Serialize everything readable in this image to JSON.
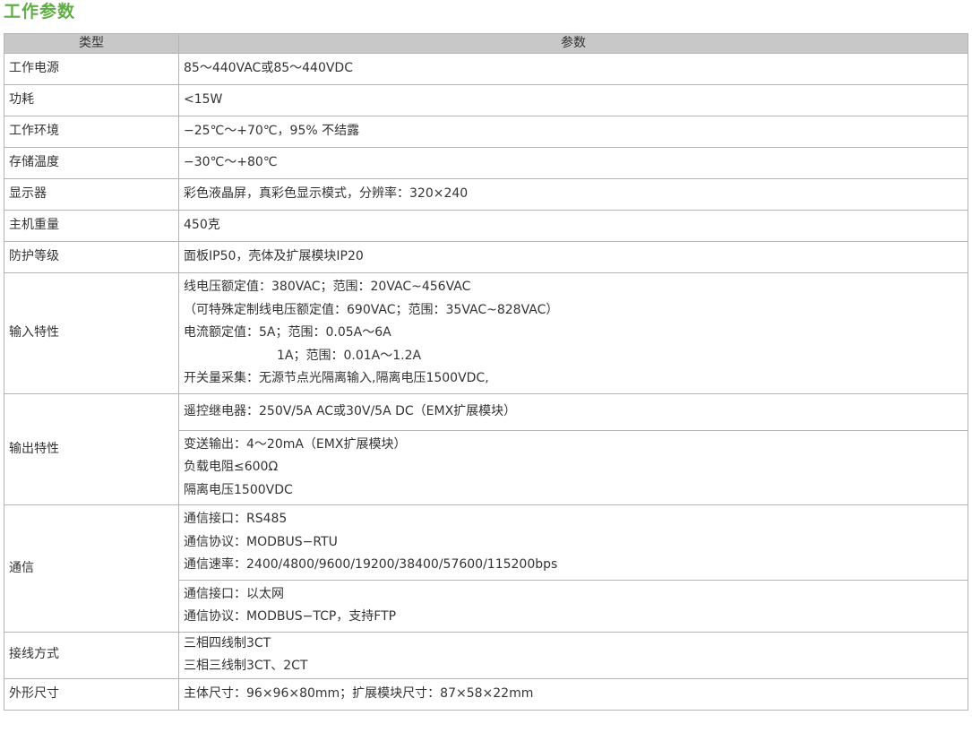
{
  "page": {
    "title": "工作参数"
  },
  "table": {
    "headers": {
      "type": "类型",
      "param": "参数"
    },
    "rows": {
      "power": {
        "label": "工作电源",
        "value": "85～440VAC或85～440VDC"
      },
      "consumption": {
        "label": "功耗",
        "value": "<15W"
      },
      "env": {
        "label": "工作环境",
        "value": "−25℃～+70℃，95% 不结露"
      },
      "storage": {
        "label": "存储温度",
        "value": "−30℃～+80℃"
      },
      "display": {
        "label": "显示器",
        "value": "彩色液晶屏，真彩色显示模式，分辨率：320×240"
      },
      "weight": {
        "label": "主机重量",
        "value": "450克"
      },
      "protection": {
        "label": "防护等级",
        "value": "面板IP50，壳体及扩展模块IP20"
      },
      "input": {
        "label": "输入特性",
        "lines": [
          "线电压额定值：380VAC；范围：20VAC~456VAC",
          "（可特殊定制线电压额定值：690VAC；范围：35VAC~828VAC）",
          "电流额定值：5A；范围：0.05A～6A",
          "1A；范围：0.01A～1.2A",
          "开关量采集：无源节点光隔离输入,隔离电压1500VDC,"
        ]
      },
      "output": {
        "label": "输出特性",
        "relay": "遥控继电器：250V/5A AC或30V/5A DC（EMX扩展模块）",
        "lines": [
          "变送输出：4～20mA（EMX扩展模块）",
          "负载电阻≤600Ω",
          "隔离电压1500VDC"
        ]
      },
      "comm": {
        "label": "通信",
        "rs485": [
          "通信接口：RS485",
          "通信协议：MODBUS−RTU",
          "通信速率：2400/4800/9600/19200/38400/57600/115200bps"
        ],
        "ethernet": [
          "通信接口：以太网",
          "通信协议：MODBUS−TCP，支持FTP"
        ]
      },
      "wiring": {
        "label": "接线方式",
        "lines": [
          "三相四线制3CT",
          "三相三线制3CT、2CT"
        ]
      },
      "size": {
        "label": "外形尺寸",
        "value": "主体尺寸：96×96×80mm；扩展模块尺寸：87×58×22mm"
      }
    }
  }
}
